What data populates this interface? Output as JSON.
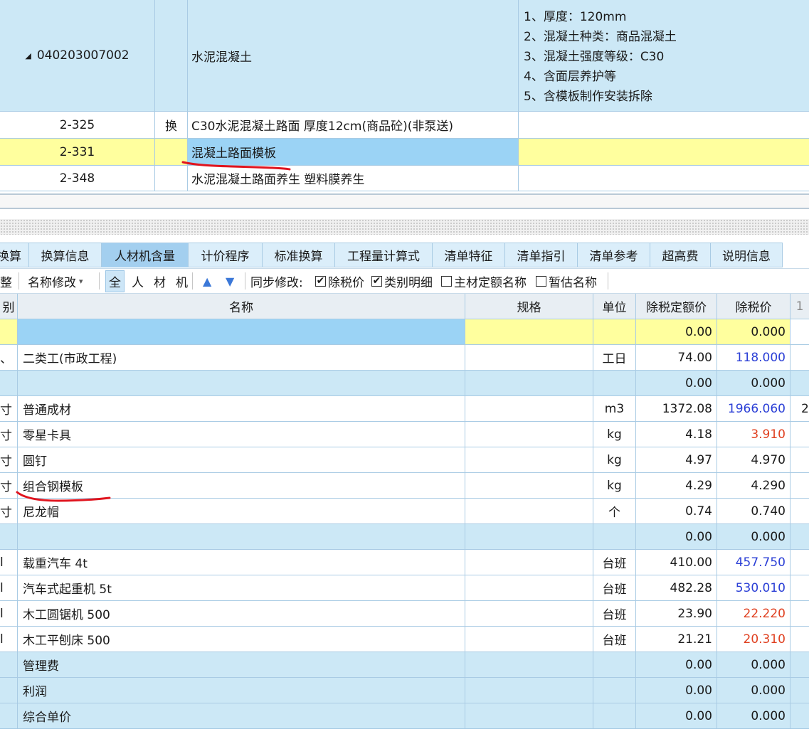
{
  "top_grid": {
    "bill_row": {
      "code": "040203007002",
      "name": "水泥混凝土",
      "features": [
        "1、厚度：120mm",
        "2、混凝土种类：商品混凝土",
        "3、混凝土强度等级：C30",
        "4、含面层养护等",
        "5、含模板制作安装拆除"
      ]
    },
    "sub_rows": [
      {
        "code": "2-325",
        "flag": "换",
        "name": "C30水泥混凝土路面 厚度12cm(商品砼)(非泵送)"
      },
      {
        "code": "2-331",
        "flag": "",
        "name": "混凝土路面模板"
      },
      {
        "code": "2-348",
        "flag": "",
        "name": "水泥混凝土路面养生 塑料膜养生"
      }
    ]
  },
  "tabs": [
    {
      "label": "换算"
    },
    {
      "label": "换算信息"
    },
    {
      "label": "人材机含量"
    },
    {
      "label": "计价程序"
    },
    {
      "label": "标准换算"
    },
    {
      "label": "工程量计算式"
    },
    {
      "label": "清单特征"
    },
    {
      "label": "清单指引"
    },
    {
      "label": "清单参考"
    },
    {
      "label": "超高费"
    },
    {
      "label": "说明信息"
    }
  ],
  "active_tab": "人材机含量",
  "toolbar": {
    "adjust_label": "整",
    "rename_label": "名称修改",
    "rename_caret": "▾",
    "filters": [
      "全",
      "人",
      "材",
      "机"
    ],
    "sync_label": "同步修改:",
    "checkboxes": [
      {
        "label": "除税价",
        "checked": true
      },
      {
        "label": "类别明细",
        "checked": true
      },
      {
        "label": "主材定额名称",
        "checked": false
      },
      {
        "label": "暂估名称",
        "checked": false
      }
    ]
  },
  "lower_grid": {
    "headers": {
      "category": "别",
      "name": "名称",
      "spec": "规格",
      "unit": "单位",
      "price": "除税定额价",
      "tax_price": "除税价",
      "extra": "1"
    },
    "rows": [
      {
        "cat": "",
        "name": "",
        "unit": "",
        "price": "0.00",
        "tax_price": "0.000",
        "kind": "yellow-sel",
        "tax_color": ""
      },
      {
        "cat": "、",
        "name": "二类工(市政工程)",
        "unit": "工日",
        "price": "74.00",
        "tax_price": "118.000",
        "kind": "white",
        "tax_color": "blue"
      },
      {
        "cat": "",
        "name": "",
        "unit": "",
        "price": "0.00",
        "tax_price": "0.000",
        "kind": "blue",
        "tax_color": ""
      },
      {
        "cat": "寸",
        "name": "普通成材",
        "unit": "m3",
        "price": "1372.08",
        "tax_price": "1966.060",
        "kind": "white",
        "tax_color": "blue",
        "extra": "2"
      },
      {
        "cat": "寸",
        "name": "零星卡具",
        "unit": "kg",
        "price": "4.18",
        "tax_price": "3.910",
        "kind": "white",
        "tax_color": "red"
      },
      {
        "cat": "寸",
        "name": "圆钉",
        "unit": "kg",
        "price": "4.97",
        "tax_price": "4.970",
        "kind": "white",
        "tax_color": ""
      },
      {
        "cat": "寸",
        "name": "组合钢模板",
        "unit": "kg",
        "price": "4.29",
        "tax_price": "4.290",
        "kind": "white",
        "tax_color": ""
      },
      {
        "cat": "寸",
        "name": "尼龙帽",
        "unit": "个",
        "price": "0.74",
        "tax_price": "0.740",
        "kind": "white",
        "tax_color": ""
      },
      {
        "cat": "",
        "name": "",
        "unit": "",
        "price": "0.00",
        "tax_price": "0.000",
        "kind": "blue",
        "tax_color": ""
      },
      {
        "cat": "l",
        "name": "载重汽车 4t",
        "unit": "台班",
        "price": "410.00",
        "tax_price": "457.750",
        "kind": "white",
        "tax_color": "blue"
      },
      {
        "cat": "l",
        "name": "汽车式起重机 5t",
        "unit": "台班",
        "price": "482.28",
        "tax_price": "530.010",
        "kind": "white",
        "tax_color": "blue"
      },
      {
        "cat": "l",
        "name": "木工圆锯机 500",
        "unit": "台班",
        "price": "23.90",
        "tax_price": "22.220",
        "kind": "white",
        "tax_color": "red"
      },
      {
        "cat": "l",
        "name": "木工平刨床 500",
        "unit": "台班",
        "price": "21.21",
        "tax_price": "20.310",
        "kind": "white",
        "tax_color": "red"
      },
      {
        "cat": "",
        "name": "管理费",
        "unit": "",
        "price": "0.00",
        "tax_price": "0.000",
        "kind": "blue",
        "tax_color": ""
      },
      {
        "cat": "",
        "name": "利润",
        "unit": "",
        "price": "0.00",
        "tax_price": "0.000",
        "kind": "blue",
        "tax_color": ""
      },
      {
        "cat": "",
        "name": "综合单价",
        "unit": "",
        "price": "0.00",
        "tax_price": "0.000",
        "kind": "blue",
        "tax_color": ""
      }
    ]
  },
  "colors": {
    "row_blue": "#cce8f6",
    "row_yellow": "#ffff9e",
    "selected_cell": "#9bd3f5",
    "value_blue": "#2b3fd6",
    "value_red": "#e04020",
    "annotation_red": "#e0141e"
  },
  "icons": {
    "expand": "triangle-collapse-icon",
    "up": "arrow-up-icon",
    "down": "arrow-down-icon"
  }
}
